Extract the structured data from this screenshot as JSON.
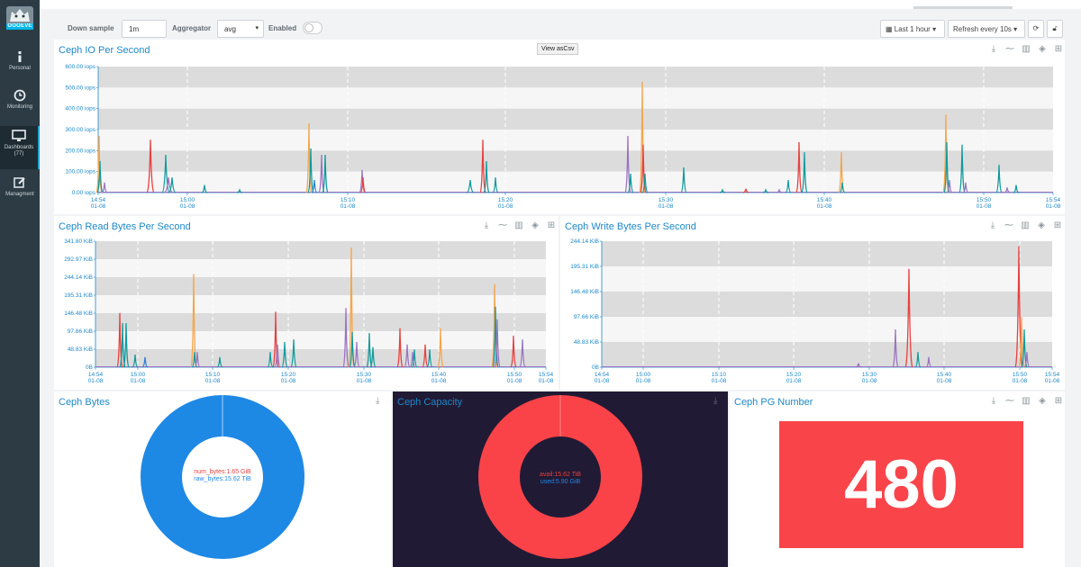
{
  "app": {
    "logo_text": "OOOEVE"
  },
  "sidebar": {
    "items": [
      {
        "label": "Personal",
        "icon": "info-icon"
      },
      {
        "label": "Monitoring",
        "icon": "clock-icon"
      },
      {
        "label": "Dashboards",
        "sub": "(77)",
        "icon": "monitor-icon",
        "active": true
      },
      {
        "label": "Managment",
        "icon": "edit-icon"
      }
    ]
  },
  "toolbar": {
    "downsample_label": "Down sample",
    "downsample_value": "1m",
    "aggregator_label": "Aggregator",
    "aggregator_value": "avg",
    "enabled_label": "Enabled",
    "timerange": "Last 1 hour",
    "refresh": "Refresh every 10s"
  },
  "panels": {
    "io": {
      "title": "Ceph IO Per Second",
      "view_btn": "View",
      "ascsv_btn": "asCsv",
      "yticks": [
        "600.00 iops",
        "500.00 iops",
        "400.00 iops",
        "300.00 iops",
        "200.00 iops",
        "100.00 iops",
        "0.00 iops"
      ],
      "xticks": [
        [
          "14:54",
          "01-08"
        ],
        [
          "15:00",
          "01-08"
        ],
        [
          "15:10",
          "01-08"
        ],
        [
          "15:20",
          "01-08"
        ],
        [
          "15:30",
          "01-08"
        ],
        [
          "15:40",
          "01-08"
        ],
        [
          "15:50",
          "01-08"
        ],
        [
          "15:54",
          "01-08"
        ]
      ]
    },
    "read": {
      "title": "Ceph Read Bytes Per Second",
      "yticks": [
        "341.80 KiB",
        "292.97 KiB",
        "244.14 KiB",
        "195.31 KiB",
        "146.48 KiB",
        "97.66 KiB",
        "48.83 KiB",
        "0B"
      ],
      "xticks": [
        [
          "14:54",
          "01-08"
        ],
        [
          "15:00",
          "01-08"
        ],
        [
          "15:10",
          "01-08"
        ],
        [
          "15:20",
          "01-08"
        ],
        [
          "15:30",
          "01-08"
        ],
        [
          "15:40",
          "01-08"
        ],
        [
          "15:50",
          "01-08"
        ],
        [
          "15:54",
          "01-08"
        ]
      ]
    },
    "write": {
      "title": "Ceph Write Bytes Per Second",
      "yticks": [
        "244.14 KiB",
        "195.31 KiB",
        "146.48 KiB",
        "97.66 KiB",
        "48.83 KiB",
        "0B"
      ],
      "xticks": [
        [
          "14:54",
          "01-08"
        ],
        [
          "15:00",
          "01-08"
        ],
        [
          "15:10",
          "01-08"
        ],
        [
          "15:20",
          "01-08"
        ],
        [
          "15:30",
          "01-08"
        ],
        [
          "15:40",
          "01-08"
        ],
        [
          "15:50",
          "01-08"
        ],
        [
          "15:54",
          "01-08"
        ]
      ]
    },
    "bytes": {
      "title": "Ceph Bytes",
      "line1": "num_bytes:1.65 GiB",
      "line2": "raw_bytes:15.62 TiB",
      "color": "#1e88e5"
    },
    "capacity": {
      "title": "Ceph Capacity",
      "line1": "avail:15.62 TiB",
      "line2": "used:5.90 GiB",
      "color": "#f94348"
    },
    "pg": {
      "title": "Ceph PG Number",
      "value": "480"
    }
  },
  "colors": {
    "orange": "#f6a54a",
    "red": "#e8403e",
    "teal": "#109a9c",
    "purple": "#9b73c1",
    "blue": "#2f7fd2",
    "accent": "#1e88c7"
  }
}
